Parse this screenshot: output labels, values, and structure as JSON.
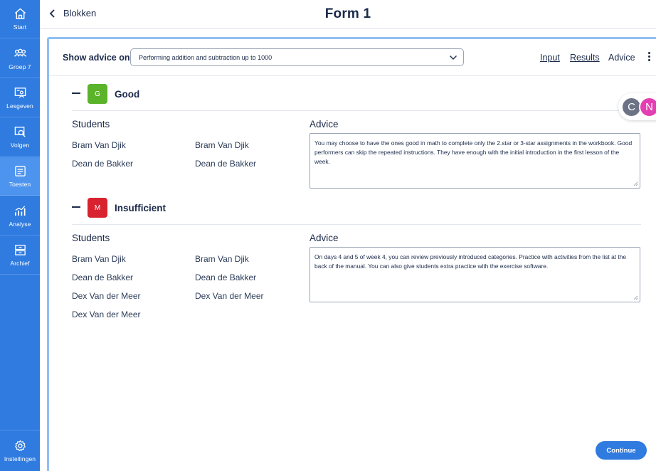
{
  "sidebar": {
    "items": [
      {
        "label": "Start",
        "icon": "home-icon"
      },
      {
        "label": "Groep 7",
        "icon": "group-icon"
      },
      {
        "label": "Lesgeven",
        "icon": "teach-icon"
      },
      {
        "label": "Volgen",
        "icon": "follow-icon"
      },
      {
        "label": "Toesten",
        "icon": "test-icon"
      },
      {
        "label": "Analyse",
        "icon": "analysis-icon"
      },
      {
        "label": "Archief",
        "icon": "archive-icon"
      },
      {
        "label": "Instellingen",
        "icon": "settings-icon"
      }
    ],
    "active_index": 4
  },
  "header": {
    "back_label": "Blokken",
    "title": "Form 1"
  },
  "toolbar": {
    "show_advice_label": "Show advice on",
    "select_value": "Performing addition and subtraction up to 1000",
    "tabs": [
      {
        "label": "Input",
        "active": false
      },
      {
        "label": "Results",
        "active": false
      },
      {
        "label": "Advice",
        "active": true
      }
    ]
  },
  "avatars": [
    {
      "initial": "C",
      "color": "#6b7385"
    },
    {
      "initial": "N",
      "color": "#e43fb2"
    }
  ],
  "sections": [
    {
      "badge": "G",
      "badge_color": "#5bb32a",
      "title": "Good",
      "students_label": "Students",
      "advice_label": "Advice",
      "students": [
        "Bram Van Djik",
        "Bram Van Djik",
        "Dean de Bakker",
        "Dean de Bakker"
      ],
      "advice": "You may choose to have the ones good in math to complete only the 2.star or 3-star assignments in the workbook. Good performers can skip the repeated instructions. They have enough with the initial introduction in the first lesson of the week."
    },
    {
      "badge": "M",
      "badge_color": "#d9222f",
      "title": "Insufficient",
      "students_label": "Students",
      "advice_label": "Advice",
      "students": [
        "Bram Van Djik",
        "Bram Van Djik",
        "Dean de Bakker",
        "Dean de Bakker",
        "Dex Van der Meer",
        "Dex Van der Meer",
        "Dex Van der Meer"
      ],
      "advice": "On days 4 and 5 of week 4, you can review previously introduced categories. Practice with activities from the list at the back of the manual. You can also give students extra practice with the exercise software."
    }
  ],
  "footer": {
    "continue_label": "Continue"
  }
}
